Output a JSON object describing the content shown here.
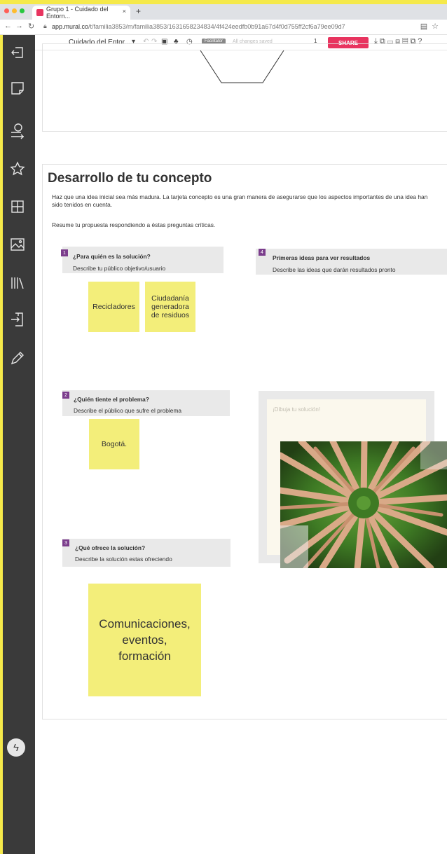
{
  "browser": {
    "tab_title": "Grupo 1 - Cuidado del Entorn...",
    "tab_close": "×",
    "new_tab": "+",
    "url_host": "app.mural.co",
    "url_path": "/t/familia3853/m/familia3853/1631658234834/4f424eedfb0b91a67d4f0d755ff2cf6a79ee09d7"
  },
  "toolbar": {
    "mural_title": "Cuidado del Entor...",
    "facilitator_badge": "Facilitator",
    "status": "All changes saved",
    "share_label": "SHARE",
    "collaborators": "1"
  },
  "concept": {
    "title": "Desarrollo de tu concepto",
    "description": "Haz que una idea inicial sea más madura. La tarjeta concepto es una gran manera de asegurarse que los aspectos importantes de una idea han sido tenidos en cuenta.",
    "instruction": "Resume tu propuesta respondiendo a éstas preguntas críticas."
  },
  "questions": [
    {
      "number": "1",
      "title": "¿Para quién es la solución?",
      "subtitle": "Describe tu público objetivo/usuario"
    },
    {
      "number": "2",
      "title": "¿Quién tiente el problema?",
      "subtitle": "Describe el público que sufre el problema"
    },
    {
      "number": "3",
      "title": "¿Qué ofrece la solución?",
      "subtitle": "Describe la solución estas ofreciendo"
    },
    {
      "number": "4",
      "title": "Primeras ideas para ver resultados",
      "subtitle": "Describe las ideas que darán resultados pronto"
    }
  ],
  "stickies": {
    "recicladores": "Recicladores",
    "ciudadania": "Ciudadanía generadora de residuos",
    "bogota": "Bogotá.",
    "comunicaciones": "Comunicaciones, eventos, formación"
  },
  "drawing": {
    "placeholder": "¡Dibuja tu solución!"
  },
  "colors": {
    "sticky": "#f3ee7a",
    "share": "#e8345f",
    "sidebar": "#3a3a3a",
    "number_badge": "#7b3d8c",
    "question_box": "#e9e9e9"
  },
  "icons": {
    "sidebar": [
      "exit-icon",
      "sticky-note-icon",
      "template-icon",
      "star-icon",
      "grid-icon",
      "image-icon",
      "library-icon",
      "import-icon",
      "pencil-icon"
    ],
    "bottom": "bolt-icon"
  }
}
